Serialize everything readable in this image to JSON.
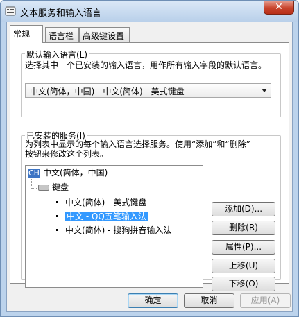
{
  "window": {
    "title": "文本服务和输入语言",
    "close_label": "✕"
  },
  "tabs": [
    {
      "label": "常规",
      "active": true
    },
    {
      "label": "语言栏",
      "active": false
    },
    {
      "label": "高级键设置",
      "active": false
    }
  ],
  "default_language": {
    "label": "默认输入语言(L)",
    "description": "选择其中一个已安装的输入语言，用作所有输入字段的默认语言。",
    "selected": "中文(简体，中国) - 中文(简体) - 美式键盘"
  },
  "installed_services": {
    "label": "已安装的服务(I)",
    "description_line1": "为列表中显示的每个输入语言选择服务。使用“添加”和“删除”",
    "description_line2": "按钮来修改这个列表。",
    "tree": {
      "language_badge": "CH",
      "language": "中文(简体，中国)",
      "group": "键盘",
      "items": [
        {
          "label": "中文(简体) - 美式键盘",
          "selected": false
        },
        {
          "label": "中文 - QQ五笔输入法",
          "selected": true
        },
        {
          "label": "中文(简体) - 搜狗拼音输入法",
          "selected": false
        }
      ]
    }
  },
  "side_buttons": {
    "add": "添加(D)...",
    "remove": "删除(R)",
    "properties": "属性(P)...",
    "move_up": "上移(U)",
    "move_down": "下移(O)"
  },
  "footer_buttons": {
    "ok": "确定",
    "cancel": "取消",
    "apply": "应用(A)"
  },
  "colors": {
    "highlight_box": "#e02020",
    "selection": "#3399ff",
    "language_badge": "#3d74c4"
  }
}
